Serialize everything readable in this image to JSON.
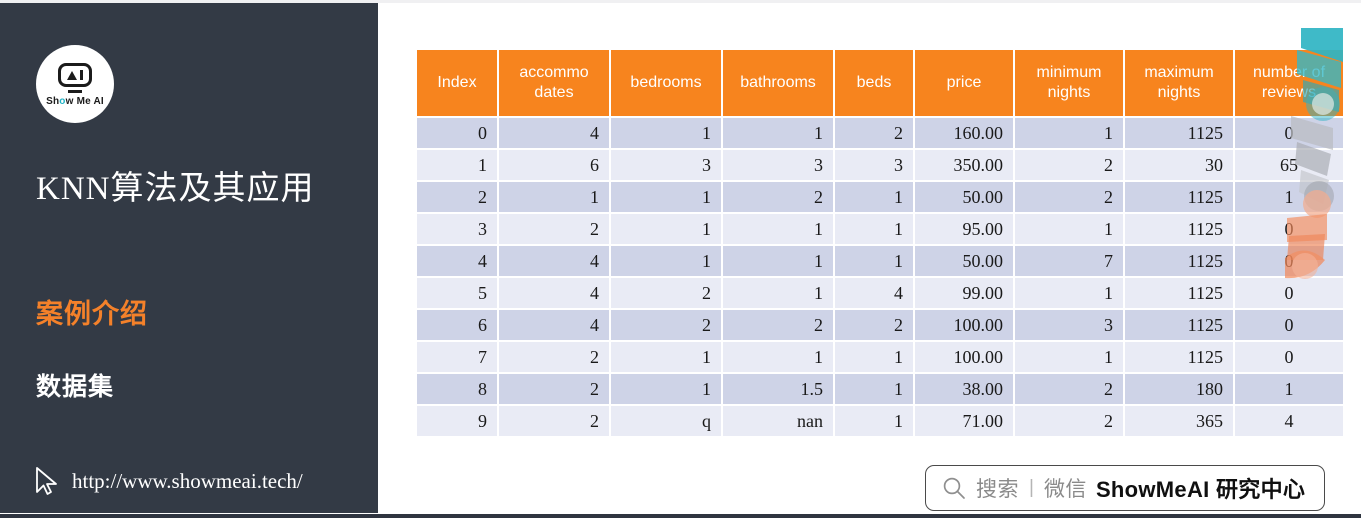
{
  "sidebar": {
    "logo": {
      "icon": "showmeai-robot-logo",
      "text_before_dot": "Sh",
      "dot": "o",
      "text_after_dot": "w Me AI"
    },
    "deck_title": "KNN算法及其应用",
    "section_title": "案例介绍",
    "sub_title": "数据集",
    "footer": {
      "cursor_icon": "cursor-pointer-icon",
      "url": "http://www.showmeai.tech/"
    }
  },
  "searchbar": {
    "icon": "search-icon",
    "placeholder": "搜索",
    "separator": "|",
    "channel": "微信",
    "brand": "ShowMeAI 研究中心"
  },
  "watermark": {
    "name": "showmeai-decorative-watermark"
  },
  "colors": {
    "sidebar_bg": "#333a45",
    "header_orange": "#f7841e",
    "accent_orange": "#f4812a",
    "row_even": "#ced3e7",
    "row_odd": "#e9ebf5",
    "text_dark": "#1a1a1a",
    "panel_bg": "#ffffff"
  },
  "table": {
    "columns": [
      "Index",
      "accommo dates",
      "bedrooms",
      "bathrooms",
      "beds",
      "price",
      "minimum nights",
      "maximum nights",
      "number of reviews"
    ],
    "rows": [
      {
        "index": "0",
        "accommodates": "4",
        "bedrooms": "1",
        "bathrooms": "1",
        "beds": "2",
        "price": "160.00",
        "minimum_nights": "1",
        "maximum_nights": "1125",
        "number_of_reviews": "0"
      },
      {
        "index": "1",
        "accommodates": "6",
        "bedrooms": "3",
        "bathrooms": "3",
        "beds": "3",
        "price": "350.00",
        "minimum_nights": "2",
        "maximum_nights": "30",
        "number_of_reviews": "65"
      },
      {
        "index": "2",
        "accommodates": "1",
        "bedrooms": "1",
        "bathrooms": "2",
        "beds": "1",
        "price": "50.00",
        "minimum_nights": "2",
        "maximum_nights": "1125",
        "number_of_reviews": "1"
      },
      {
        "index": "3",
        "accommodates": "2",
        "bedrooms": "1",
        "bathrooms": "1",
        "beds": "1",
        "price": "95.00",
        "minimum_nights": "1",
        "maximum_nights": "1125",
        "number_of_reviews": "0"
      },
      {
        "index": "4",
        "accommodates": "4",
        "bedrooms": "1",
        "bathrooms": "1",
        "beds": "1",
        "price": "50.00",
        "minimum_nights": "7",
        "maximum_nights": "1125",
        "number_of_reviews": "0"
      },
      {
        "index": "5",
        "accommodates": "4",
        "bedrooms": "2",
        "bathrooms": "1",
        "beds": "4",
        "price": "99.00",
        "minimum_nights": "1",
        "maximum_nights": "1125",
        "number_of_reviews": "0"
      },
      {
        "index": "6",
        "accommodates": "4",
        "bedrooms": "2",
        "bathrooms": "2",
        "beds": "2",
        "price": "100.00",
        "minimum_nights": "3",
        "maximum_nights": "1125",
        "number_of_reviews": "0"
      },
      {
        "index": "7",
        "accommodates": "2",
        "bedrooms": "1",
        "bathrooms": "1",
        "beds": "1",
        "price": "100.00",
        "minimum_nights": "1",
        "maximum_nights": "1125",
        "number_of_reviews": "0"
      },
      {
        "index": "8",
        "accommodates": "2",
        "bedrooms": "1",
        "bathrooms": "1.5",
        "beds": "1",
        "price": "38.00",
        "minimum_nights": "2",
        "maximum_nights": "180",
        "number_of_reviews": "1"
      },
      {
        "index": "9",
        "accommodates": "2",
        "bedrooms": "q",
        "bathrooms": "nan",
        "beds": "1",
        "price": "71.00",
        "minimum_nights": "2",
        "maximum_nights": "365",
        "number_of_reviews": "4"
      }
    ]
  }
}
